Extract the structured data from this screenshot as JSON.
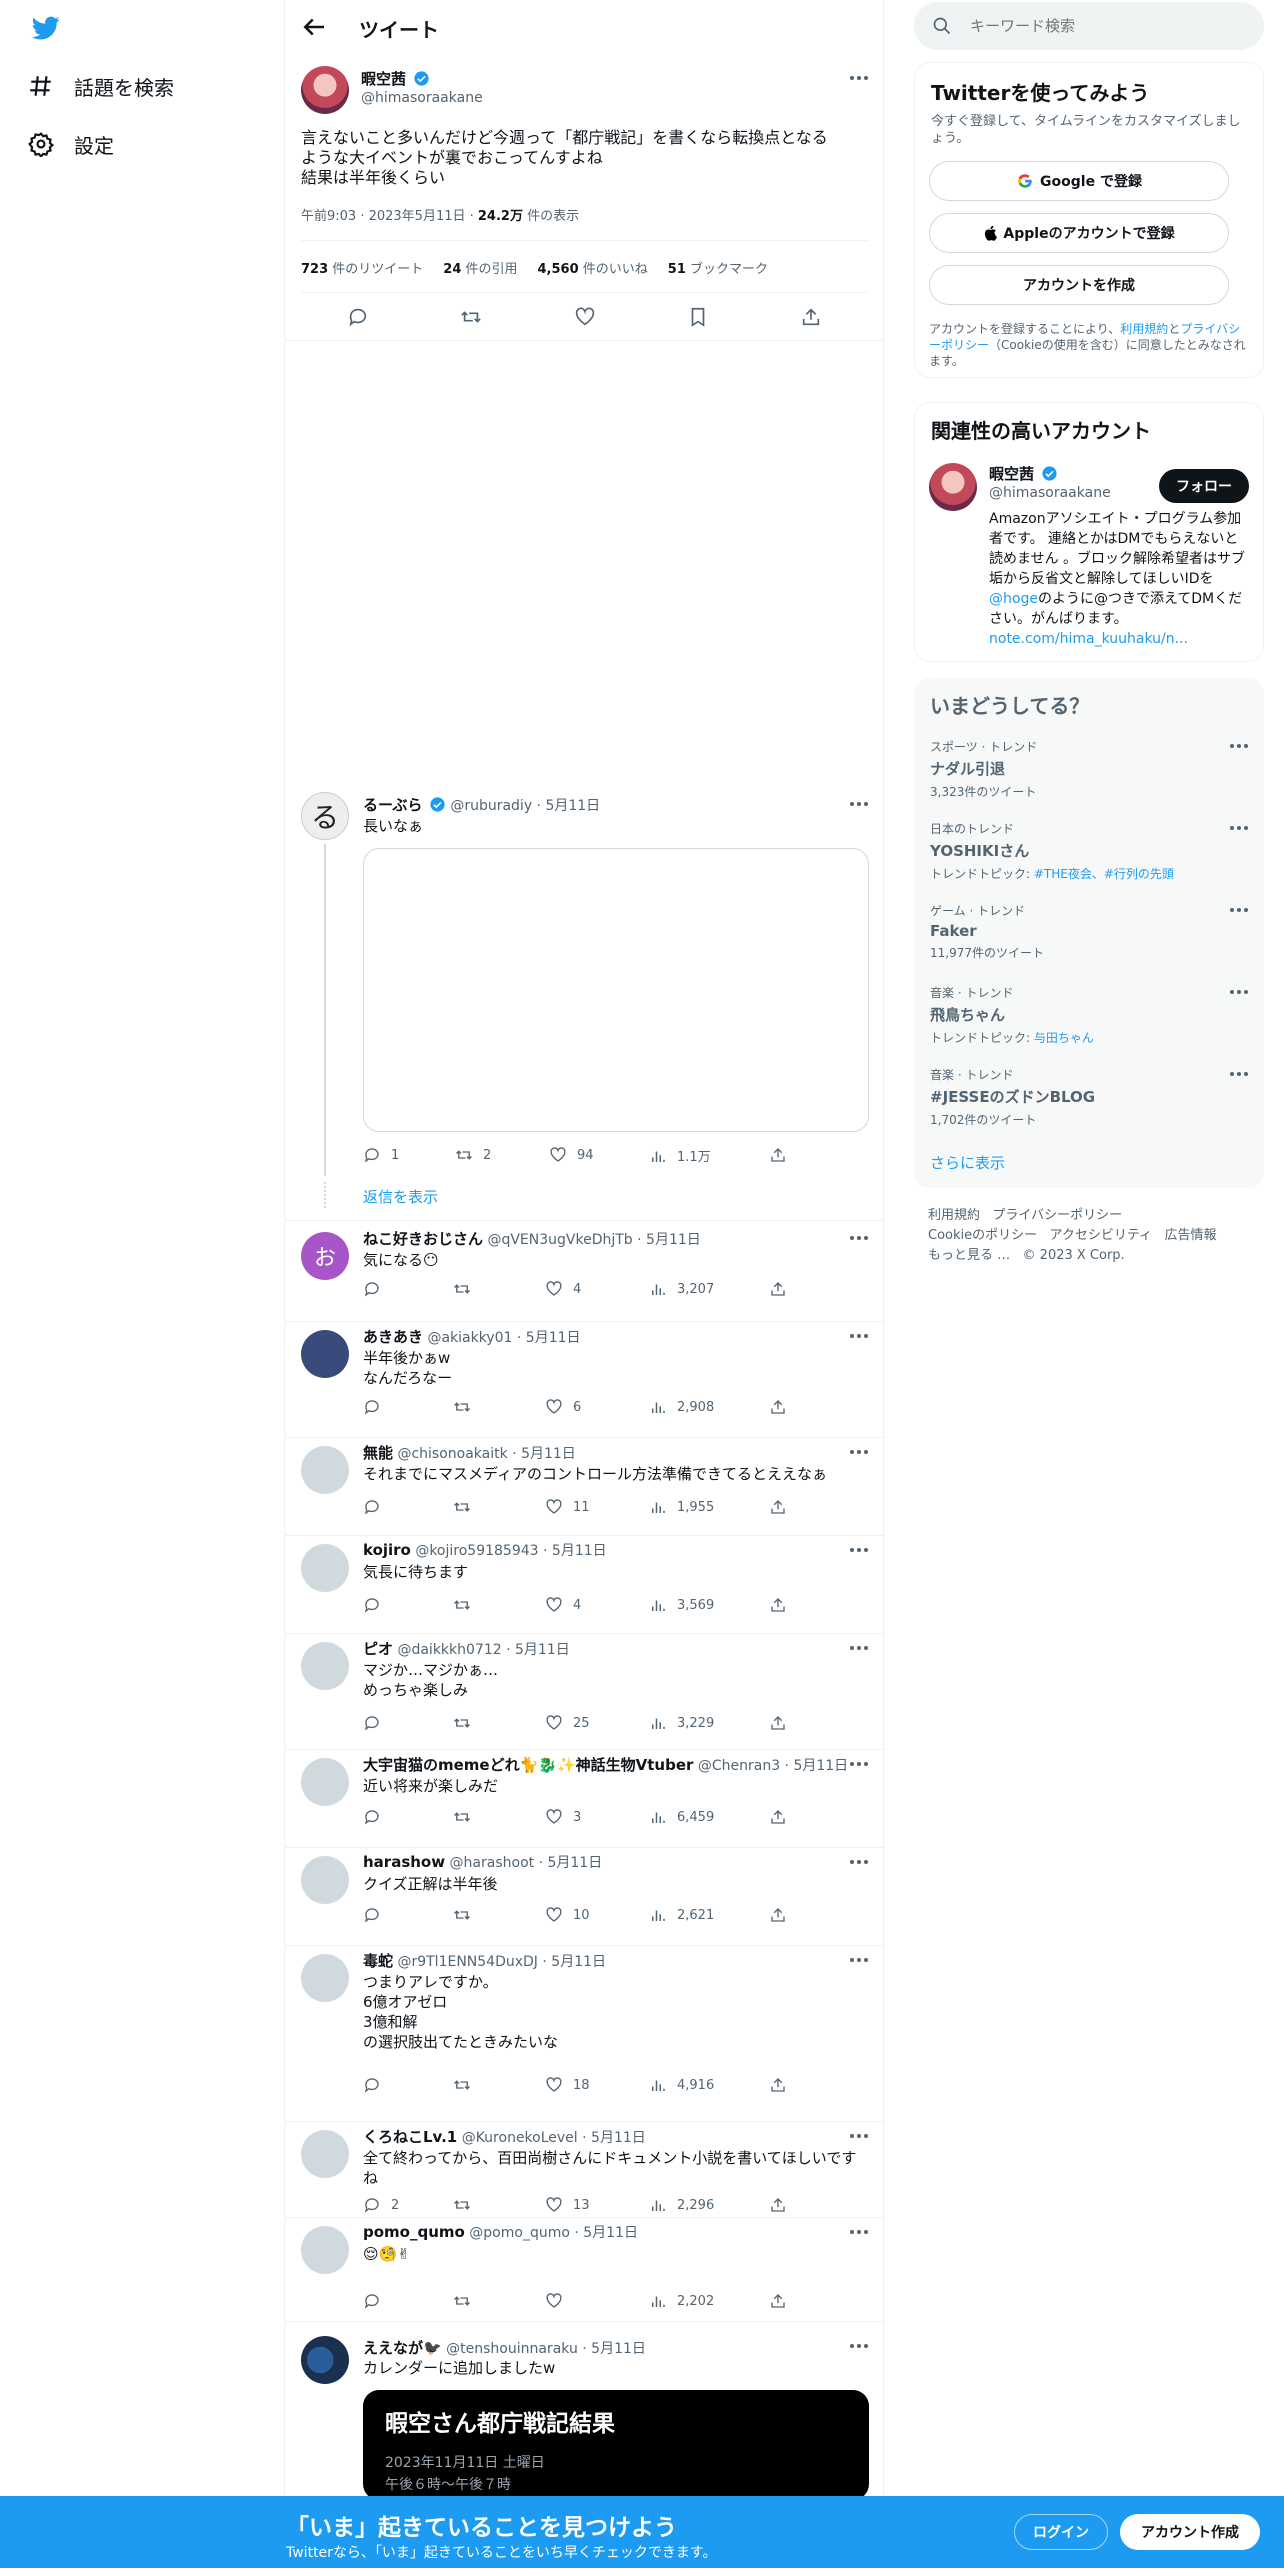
{
  "nav": {
    "explore": "話題を検索",
    "settings": "設定"
  },
  "header": {
    "title": "ツイート"
  },
  "tweet": {
    "name": "暇空茜",
    "handle": "@himasoraakane",
    "text": "言えないこと多いんだけど今週って「都庁戦記」を書くなら転換点となる\nような大イベントが裏でおこってんすよね\n結果は半年後くらい",
    "time": "午前9:03 · 2023年5月11日 · ",
    "views": "24.2万",
    "views_label": " 件の表示",
    "stats": [
      {
        "num": "723",
        "label": " 件のリツイート"
      },
      {
        "num": "24",
        "label": " 件の引用"
      },
      {
        "num": "4,560",
        "label": " 件のいいね"
      },
      {
        "num": "51",
        "label": " ブックマーク"
      }
    ]
  },
  "reply1": {
    "name": "るーぶら",
    "handle": "@ruburadiy",
    "date": " · 5月11日",
    "text": "長いなぁ",
    "replies": "1",
    "retweets": "2",
    "likes": "94",
    "views": "1.1万",
    "show_replies": "返信を表示"
  },
  "replies": [
    {
      "name": "ねこ好きおじさん",
      "handle": "@qVEN3ugVkeDhjTb",
      "date": " · 5月11日",
      "text": "気になる😶",
      "replies": "",
      "retweets": "",
      "likes": "4",
      "views": "3,207"
    },
    {
      "name": "あきあき",
      "handle": "@akiakky01",
      "date": " · 5月11日",
      "text": "半年後かぁw\nなんだろなー",
      "replies": "",
      "retweets": "",
      "likes": "6",
      "views": "2,908"
    },
    {
      "name": "無能",
      "handle": "@chisonoakaitk",
      "date": " · 5月11日",
      "text": "それまでにマスメディアのコントロール方法準備できてるとええなぁ",
      "replies": "",
      "retweets": "",
      "likes": "11",
      "views": "1,955"
    },
    {
      "name": "kojiro",
      "handle": "@kojiro59185943",
      "date": " · 5月11日",
      "text": "気長に待ちます",
      "replies": "",
      "retweets": "",
      "likes": "4",
      "views": "3,569"
    },
    {
      "name": "ピオ",
      "handle": "@daikkkh0712",
      "date": " · 5月11日",
      "text": "マジか…マジかぁ…\nめっちゃ楽しみ",
      "replies": "",
      "retweets": "",
      "likes": "25",
      "views": "3,229"
    },
    {
      "name": "大宇宙猫のmemeどれ🐈🐉✨神話生物Vtuber",
      "handle": "@Chenran3",
      "date": " · 5月11日",
      "text": "近い将来が楽しみだ",
      "replies": "",
      "retweets": "",
      "likes": "3",
      "views": "6,459"
    },
    {
      "name": "harashow",
      "handle": "@harashoot",
      "date": " · 5月11日",
      "text": "クイズ正解は半年後",
      "replies": "",
      "retweets": "",
      "likes": "10",
      "views": "2,621"
    },
    {
      "name": "毒蛇",
      "handle": "@r9Tl1ENN54DuxDJ",
      "date": " · 5月11日",
      "text": "つまりアレですか。\n6億オアゼロ\n3億和解\nの選択肢出てたときみたいな",
      "replies": "",
      "retweets": "",
      "likes": "18",
      "views": "4,916"
    },
    {
      "name": "くろねこLv.1",
      "handle": "@KuronekoLevel",
      "date": " · 5月11日",
      "text": "全て終わってから、百田尚樹さんにドキュメント小説を書いてほしいです\nね",
      "replies": "2",
      "retweets": "",
      "likes": "13",
      "views": "2,296"
    },
    {
      "name": "pomo_qumo",
      "handle": "@pomo_qumo",
      "date": " · 5月11日",
      "text": "😌🧐✌",
      "replies": "",
      "retweets": "",
      "likes": "",
      "views": "2,202"
    }
  ],
  "last_reply": {
    "name": "ええなが🐦‍⬛",
    "handle": "@tenshouinnaraku",
    "date": " · 5月11日",
    "text": "カレンダーに追加しましたw",
    "card_title": "暇空さん都庁戦記結果",
    "card_date": "2023年11月11日 土曜日",
    "card_time": "午後６時〜午後７時"
  },
  "avatar_letter": "お",
  "search": {
    "placeholder": "キーワード検索"
  },
  "signup": {
    "title": "Twitterを使ってみよう",
    "sub": "今すぐ登録して、タイムラインをカスタマイズしましょう。",
    "google": "Google で登録",
    "apple": "Appleのアカウントで登録",
    "create": "アカウントを作成",
    "legal_pre": "アカウントを登録することにより、",
    "legal_terms": "利用規約",
    "legal_and": "と",
    "legal_privacy": "プライバシーポリシー",
    "legal_cookie": "（Cookieの使用",
    "legal_post": "を含む）に同意したとみなされます。"
  },
  "related": {
    "title": "関連性の高いアカウント",
    "name": "暇空茜",
    "handle": "@himasoraakane",
    "follow": "フォロー",
    "bio1": "Amazonアソシエイト・プログラム参加者です。 連絡とかはDMでもらえないと読めません 。ブロック解除希望者はサブ垢から反省文と解除してほしいIDを",
    "bio_link": "@hoge",
    "bio2": "のように@つきで添えてDMください。がんばります。",
    "bio_url": "note.com/hima_kuuhaku/n..."
  },
  "trends": {
    "title": "いまどうしてる？",
    "items": [
      {
        "cat": "スポーツ · トレンド",
        "name": "ナダル引退",
        "sub": "3,323件のツイート",
        "topic_label": "",
        "topics": ""
      },
      {
        "cat": "日本のトレンド",
        "name": "YOSHIKIさん",
        "sub": "",
        "topic_label": "トレンドトピック: ",
        "topics": "#THE夜会、#行列の先頭"
      },
      {
        "cat": "ゲーム · トレンド",
        "name": "Faker",
        "sub": "11,977件のツイート",
        "topic_label": "",
        "topics": ""
      },
      {
        "cat": "音楽 · トレンド",
        "name": "飛鳥ちゃん",
        "sub": "",
        "topic_label": "トレンドトピック: ",
        "topics": "与田ちゃん"
      },
      {
        "cat": "音楽 · トレンド",
        "name": "#JESSEのズドンBLOG",
        "sub": "1,702件のツイート",
        "topic_label": "",
        "topics": ""
      }
    ],
    "more": "さらに表示"
  },
  "footer": {
    "links": [
      "利用規約",
      "プライバシーポリシー",
      "Cookieのポリシー",
      "アクセシビリティ",
      "広告情報",
      "もっと見る …"
    ],
    "copyright": "© 2023 X Corp."
  },
  "banner": {
    "title": "「いま」起きていることを見つけよう",
    "sub": "Twitterなら、「いま」起きていることをいち早くチェックできます。",
    "login": "ログイン",
    "signup": "アカウント作成"
  },
  "colors": {
    "accent": "#1d9bf0",
    "text": "#0f1419",
    "secondary": "#536471"
  }
}
